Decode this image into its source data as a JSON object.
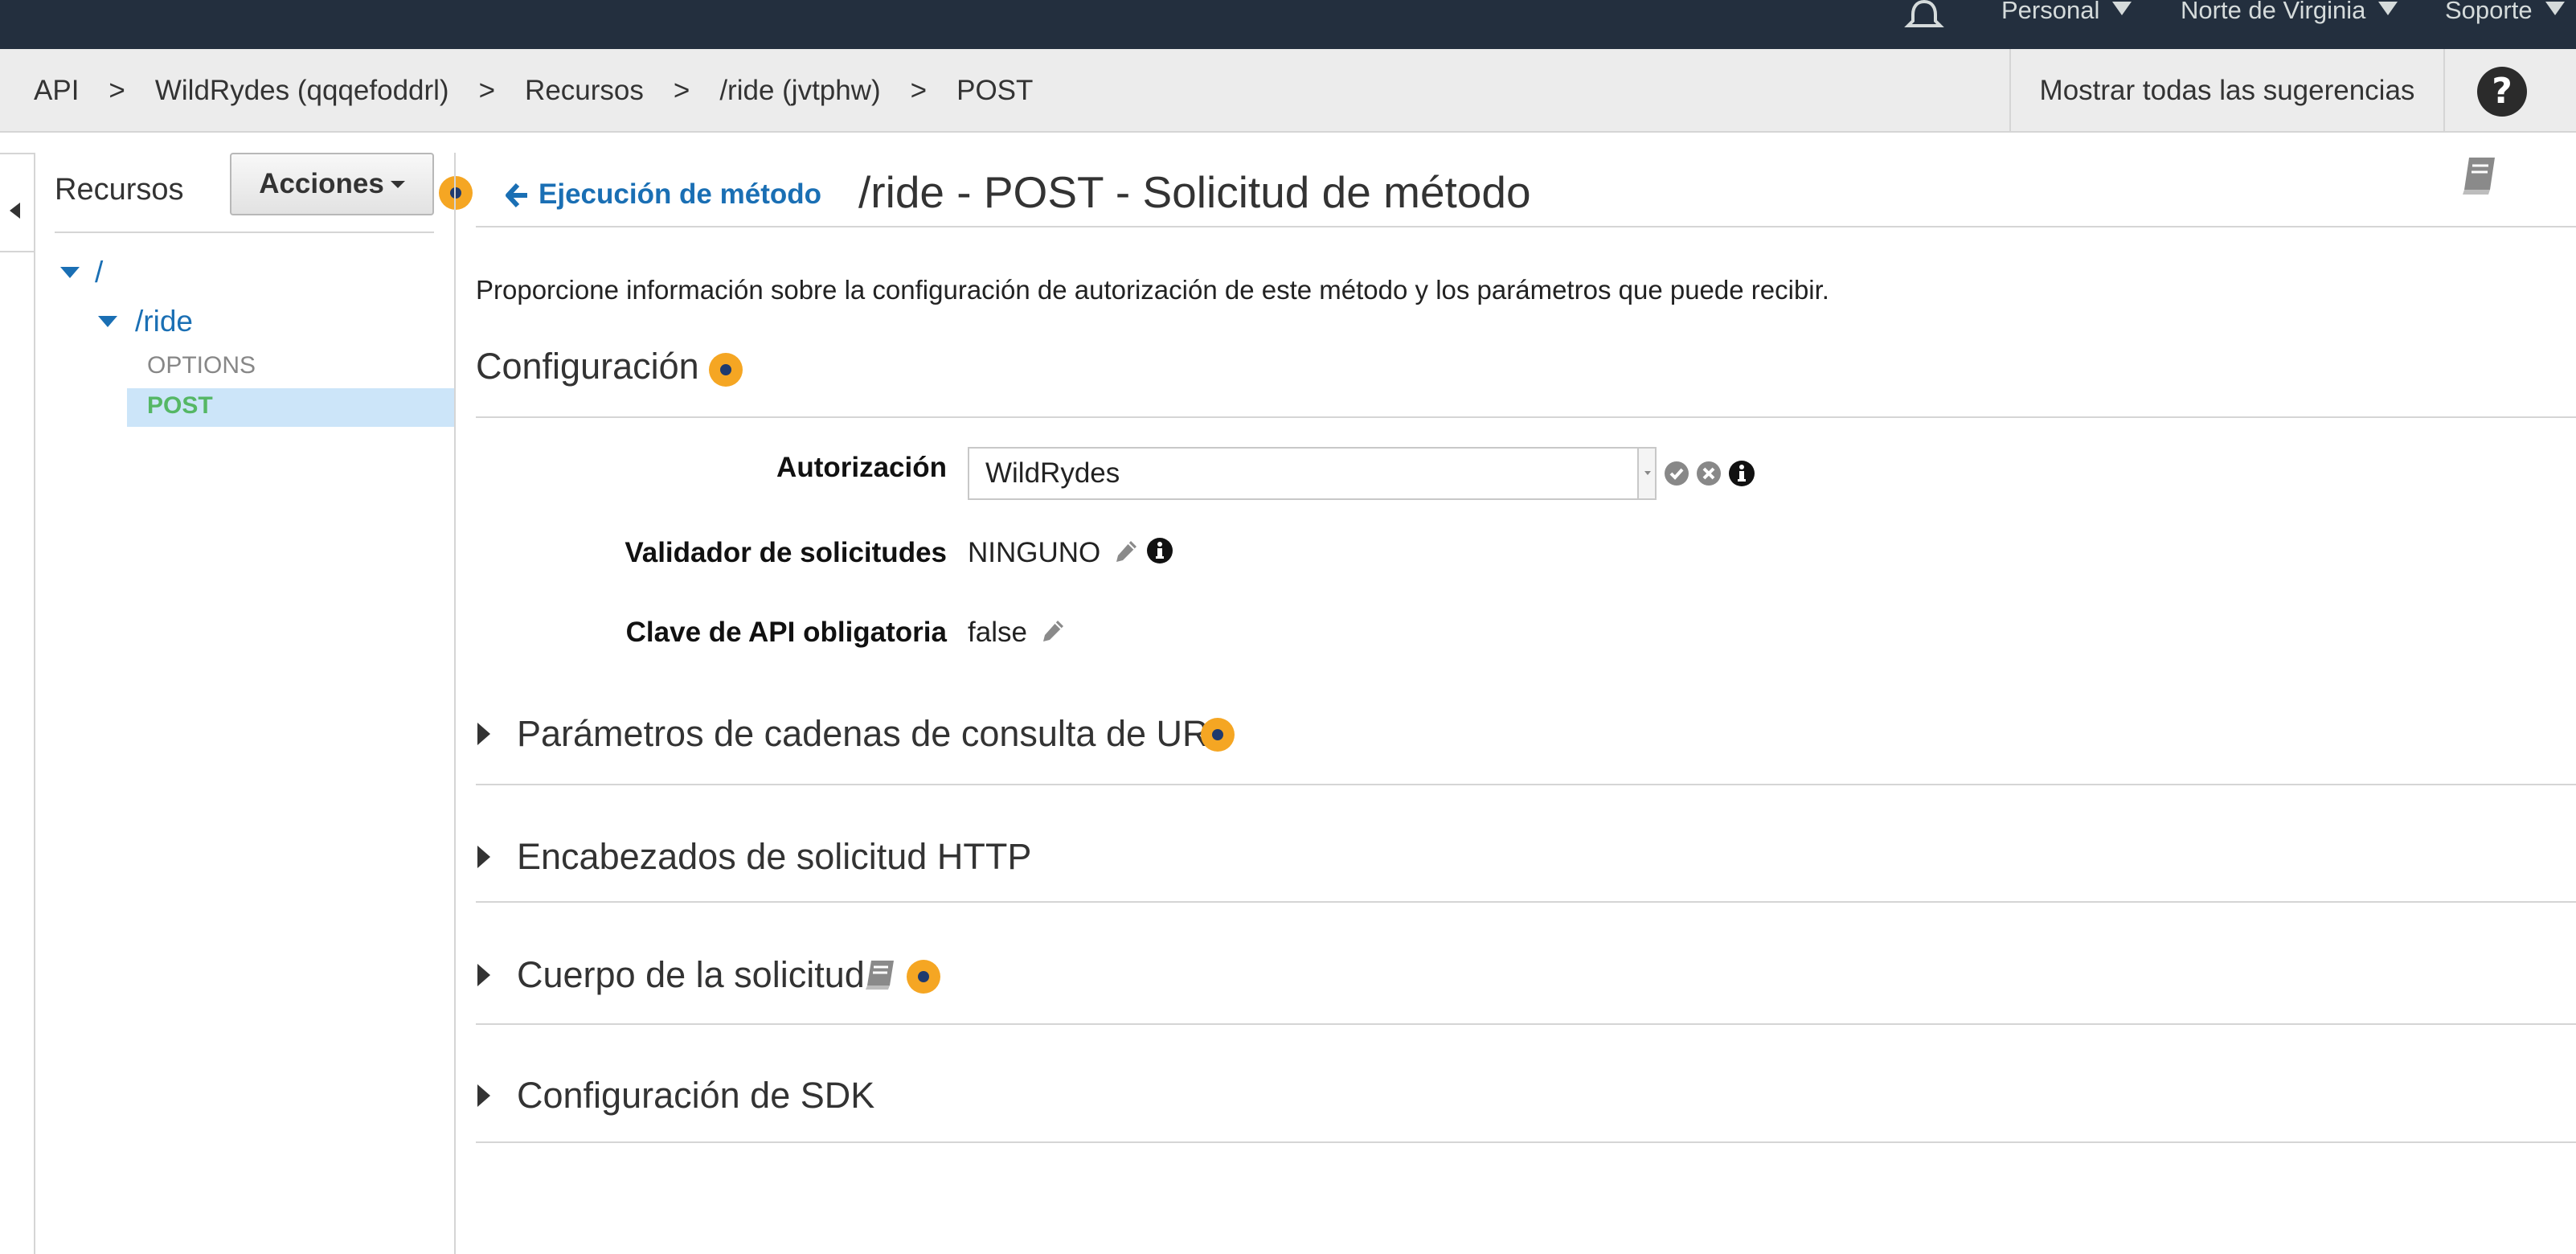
{
  "topnav": {
    "account": "Personal",
    "region": "Norte de Virginia",
    "support": "Soporte"
  },
  "breadcrumb": {
    "items": [
      "API",
      "WildRydes (qqqefoddrl)",
      "Recursos",
      "/ride (jvtphw)",
      "POST"
    ],
    "separator": ">"
  },
  "header": {
    "hints_button": "Mostrar todas las sugerencias",
    "help_glyph": "?"
  },
  "resources": {
    "title": "Recursos",
    "actions_label": "Acciones",
    "tree": {
      "root": "/",
      "child": "/ride",
      "methods": [
        "OPTIONS",
        "POST"
      ],
      "selected": "POST"
    }
  },
  "main": {
    "back_link": "Ejecución de método",
    "title": "/ride - POST - Solicitud de método",
    "description": "Proporcione información sobre la configuración de autorización de este método y los parámetros que puede recibir.",
    "settings_title": "Configuración",
    "fields": {
      "authorization_label": "Autorización",
      "authorization_value": "WildRydes",
      "validator_label": "Validador de solicitudes",
      "validator_value": "NINGUNO",
      "apikey_label": "Clave de API obligatoria",
      "apikey_value": "false"
    },
    "sections": [
      "Parámetros de cadenas de consulta de URL",
      "Encabezados de solicitud HTTP",
      "Cuerpo de la solicitud",
      "Configuración de SDK"
    ]
  },
  "colors": {
    "nav_bg": "#232f3e",
    "link_blue": "#1a6fb4",
    "post_green": "#55b765",
    "selected_bg": "#cce5f9",
    "hint_orange": "#f5a623"
  },
  "icons": [
    "bell-icon",
    "caret-down-icon",
    "help-icon",
    "collapse-arrow-icon",
    "arrow-left-icon",
    "book-icon",
    "hint-icon",
    "check-circle-icon",
    "x-circle-icon",
    "info-icon",
    "pencil-icon",
    "caret-right-icon"
  ]
}
